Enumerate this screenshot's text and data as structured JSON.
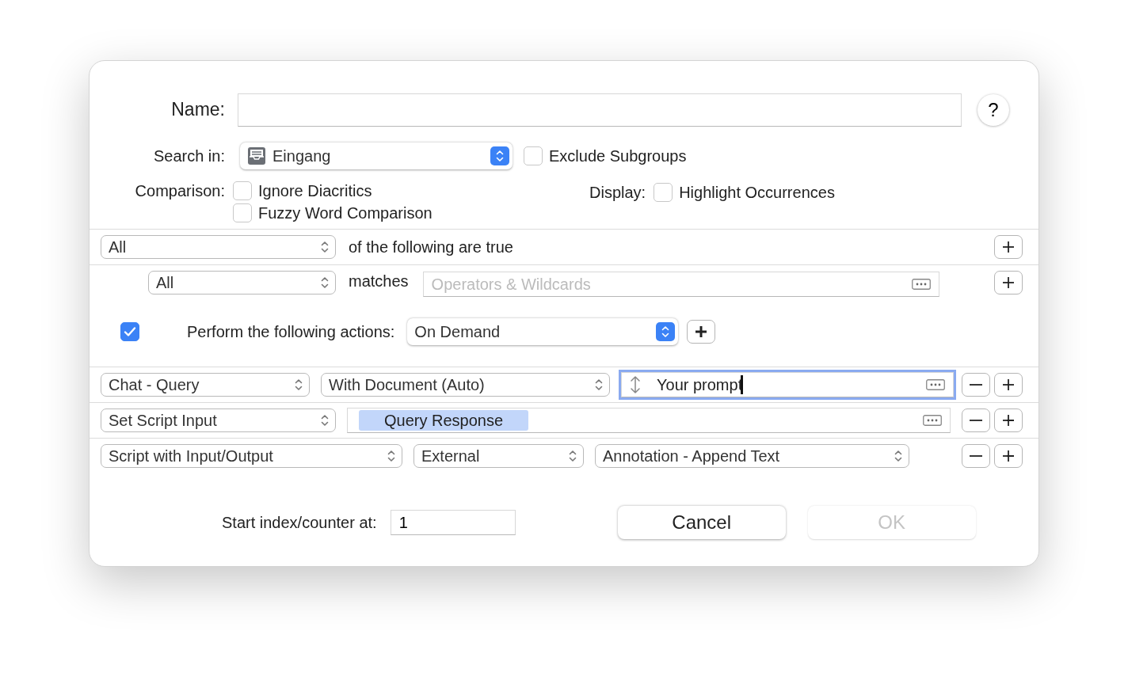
{
  "name_field": {
    "label": "Name:"
  },
  "help_button": {
    "label": "?"
  },
  "search_in": {
    "label": "Search in:",
    "value": "Eingang"
  },
  "exclude_subgroups": {
    "label": "Exclude Subgroups",
    "checked": false
  },
  "comparison": {
    "label": "Comparison:",
    "options": [
      {
        "label": "Ignore Diacritics",
        "checked": false
      },
      {
        "label": "Fuzzy Word Comparison",
        "checked": false
      }
    ]
  },
  "display": {
    "label": "Display:",
    "options": [
      {
        "label": "Highlight Occurrences",
        "checked": false
      }
    ]
  },
  "criteria": {
    "match": "All",
    "text": "of the following are true"
  },
  "condition": {
    "field": "All",
    "operator": "matches",
    "placeholder": "Operators & Wildcards"
  },
  "actions_header": {
    "checked": true,
    "label": "Perform the following actions:",
    "trigger": "On Demand"
  },
  "actions": [
    {
      "controls": [
        {
          "kind": "popup",
          "value": "Chat - Query"
        },
        {
          "kind": "popup",
          "value": "With Document (Auto)"
        },
        {
          "kind": "field",
          "value": "Your prompt",
          "focused": true
        }
      ]
    },
    {
      "controls": [
        {
          "kind": "popup",
          "value": "Set Script Input"
        },
        {
          "kind": "token_field",
          "token": "Query Response",
          "focused": false
        }
      ]
    },
    {
      "controls": [
        {
          "kind": "popup",
          "value": "Script with Input/Output"
        },
        {
          "kind": "popup",
          "value": "External"
        },
        {
          "kind": "popup",
          "value": "Annotation - Append Text"
        }
      ]
    }
  ],
  "start_index": {
    "label": "Start index/counter at:",
    "value": "1"
  },
  "buttons": [
    {
      "label": "Cancel",
      "disabled": false
    },
    {
      "label": "OK",
      "disabled": true
    }
  ]
}
